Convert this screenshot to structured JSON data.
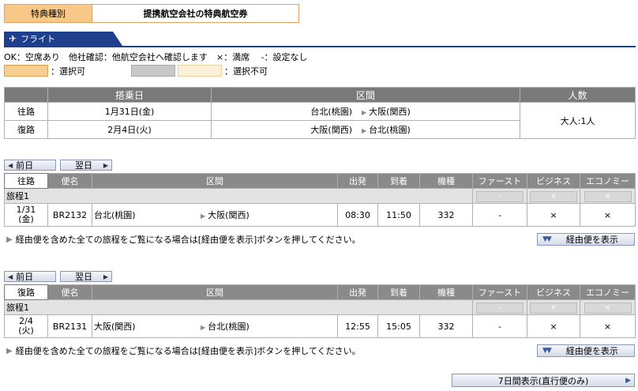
{
  "award": {
    "label": "特典種別",
    "value": "提携航空会社の特典航空券"
  },
  "flight_tab": {
    "label": "フライト",
    "icon": "airplane-icon"
  },
  "legend": {
    "line1": "OK：空席あり　他社確認：他航空会社へ確認します　×：満席　 -：設定なし",
    "selectable": "：選択可",
    "not_selectable": "：選択不可",
    "colors": {
      "selectable": "#f8cf90",
      "grey": "#c8c8c8",
      "unselectable": "#fdf0d8"
    }
  },
  "summary": {
    "headers": {
      "date": "搭乗日",
      "route": "区間",
      "pax": "人数"
    },
    "rows": [
      {
        "dir": "往路",
        "date": "1月31日(金)",
        "from": "台北(桃園)",
        "to": "大阪(関西)"
      },
      {
        "dir": "復路",
        "date": "2月4日(火)",
        "from": "大阪(関西)",
        "to": "台北(桃園)"
      }
    ],
    "pax": "大人:1人"
  },
  "nav": {
    "prev": "前日",
    "next": "翌日"
  },
  "flight_headers": {
    "flight": "便名",
    "route": "区間",
    "dep": "出発",
    "arr": "到着",
    "aircraft": "機種",
    "first": "ファースト",
    "business": "ビジネス",
    "economy": "エコノミー"
  },
  "outbound": {
    "dir": "往路",
    "itinerary": "旅程1",
    "disabled": {
      "first": "-",
      "business": "×",
      "economy": "×"
    },
    "date_line1": "1/31",
    "date_line2": "(金)",
    "flight": "BR2132",
    "from": "台北(桃園)",
    "to": "大阪(関西)",
    "dep": "08:30",
    "arr": "11:50",
    "aircraft": "332",
    "first": "-",
    "business": "×",
    "economy": "×"
  },
  "inbound": {
    "dir": "復路",
    "itinerary": "旅程1",
    "disabled": {
      "first": "-",
      "business": "×",
      "economy": "×"
    },
    "date_line1": "2/4",
    "date_line2": "(火)",
    "flight": "BR2131",
    "from": "大阪(関西)",
    "to": "台北(桃園)",
    "dep": "12:55",
    "arr": "15:05",
    "aircraft": "332",
    "first": "-",
    "business": "×",
    "economy": "×"
  },
  "note": "経由便を含めた全ての旅程をご覧になる場合は[経由便を表示]ボタンを押してください。",
  "via_button": "経由便を表示",
  "week_button": "7日間表示(直行便のみ)"
}
